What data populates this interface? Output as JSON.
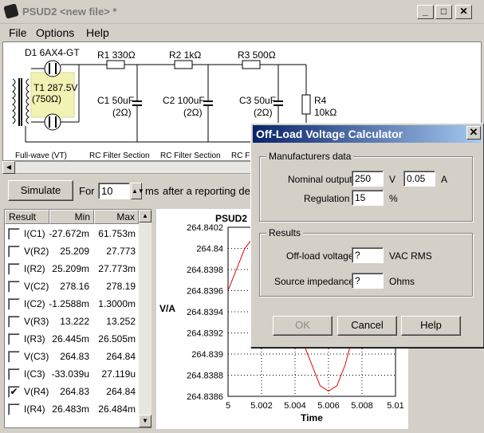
{
  "window": {
    "title": "PSUD2  <new file> *"
  },
  "menu": {
    "file": "File",
    "options": "Options",
    "help": "Help"
  },
  "schematic": {
    "d1": "D1 6AX4-GT",
    "t1": "T1 287.5V",
    "t1b": "(750Ω)",
    "r1": "R1 330Ω",
    "r2": "R2 1kΩ",
    "r3": "R3 500Ω",
    "r4": "R4",
    "r4b": "10kΩ",
    "c1": "C1 50uF",
    "c1b": "(2Ω)",
    "c2": "C2 100uF",
    "c2b": "(2Ω)",
    "c3": "C3 50uF",
    "c3b": "(2Ω)",
    "sec1": "Full-wave (VT)",
    "sec2": "RC Filter Section",
    "sec3": "RC Filter Section",
    "sec4": "RC Fil"
  },
  "sim": {
    "simulate": "Simulate",
    "for": "For",
    "duration": "10",
    "unit": "ms",
    "delay_text": "after a reporting delay o"
  },
  "results": {
    "headers": [
      "Result",
      "Min",
      "Max"
    ],
    "rows": [
      {
        "name": "I(C1)",
        "min": "-27.672m",
        "max": "61.753m",
        "checked": ""
      },
      {
        "name": "V(R2)",
        "min": "25.209",
        "max": "27.773",
        "checked": ""
      },
      {
        "name": "I(R2)",
        "min": "25.209m",
        "max": "27.773m",
        "checked": ""
      },
      {
        "name": "V(C2)",
        "min": "278.16",
        "max": "278.19",
        "checked": ""
      },
      {
        "name": "I(C2)",
        "min": "-1.2588m",
        "max": "1.3000m",
        "checked": ""
      },
      {
        "name": "V(R3)",
        "min": "13.222",
        "max": "13.252",
        "checked": ""
      },
      {
        "name": "I(R3)",
        "min": "26.445m",
        "max": "26.505m",
        "checked": ""
      },
      {
        "name": "V(C3)",
        "min": "264.83",
        "max": "264.84",
        "checked": ""
      },
      {
        "name": "I(C3)",
        "min": "-33.039u",
        "max": "27.119u",
        "checked": ""
      },
      {
        "name": "V(R4)",
        "min": "264.83",
        "max": "264.84",
        "checked": "✔"
      },
      {
        "name": "I(R4)",
        "min": "26.483m",
        "max": "26.484m",
        "checked": ""
      }
    ]
  },
  "chart_data": {
    "type": "line",
    "title": "PSUD2",
    "xlabel": "Time",
    "ylabel": "V/A",
    "xlim": [
      5,
      5.01
    ],
    "ylim": [
      264.8386,
      264.8402
    ],
    "xticks": [
      "5",
      "5.002",
      "5.004",
      "5.006",
      "5.008",
      "5.01"
    ],
    "yticks": [
      "264.8402",
      "264.84",
      "264.8398",
      "264.8396",
      "264.8394",
      "264.8392",
      "264.839",
      "264.8388",
      "264.8386"
    ],
    "series": [
      {
        "name": "V(R4)",
        "color": "#e00000",
        "x": [
          5.0,
          5.0005,
          5.001,
          5.0015,
          5.002,
          5.0025,
          5.003,
          5.0035,
          5.004,
          5.0045,
          5.005,
          5.0055,
          5.006,
          5.0065,
          5.007,
          5.0075,
          5.008
        ],
        "y": [
          264.8396,
          264.8398,
          264.84,
          264.8401,
          264.8401,
          264.84,
          264.8398,
          264.8396,
          264.8394,
          264.8391,
          264.8389,
          264.8387,
          264.83865,
          264.8387,
          264.8389,
          264.8392,
          264.8396
        ]
      }
    ]
  },
  "dialog": {
    "title": "Off-Load Voltage Calculator",
    "group1": "Manufacturers data",
    "nominal_label": "Nominal output",
    "nominal_value": "250",
    "v_unit": "V",
    "current_value": "0.05",
    "a_unit": "A",
    "regulation_label": "Regulation",
    "regulation_value": "15",
    "pct_unit": "%",
    "group2": "Results",
    "offload_label": "Off-load voltage",
    "offload_value": "?",
    "offload_unit": "VAC RMS",
    "impedance_label": "Source impedance",
    "impedance_value": "?",
    "impedance_unit": "Ohms",
    "ok": "OK",
    "cancel": "Cancel",
    "help": "Help"
  }
}
